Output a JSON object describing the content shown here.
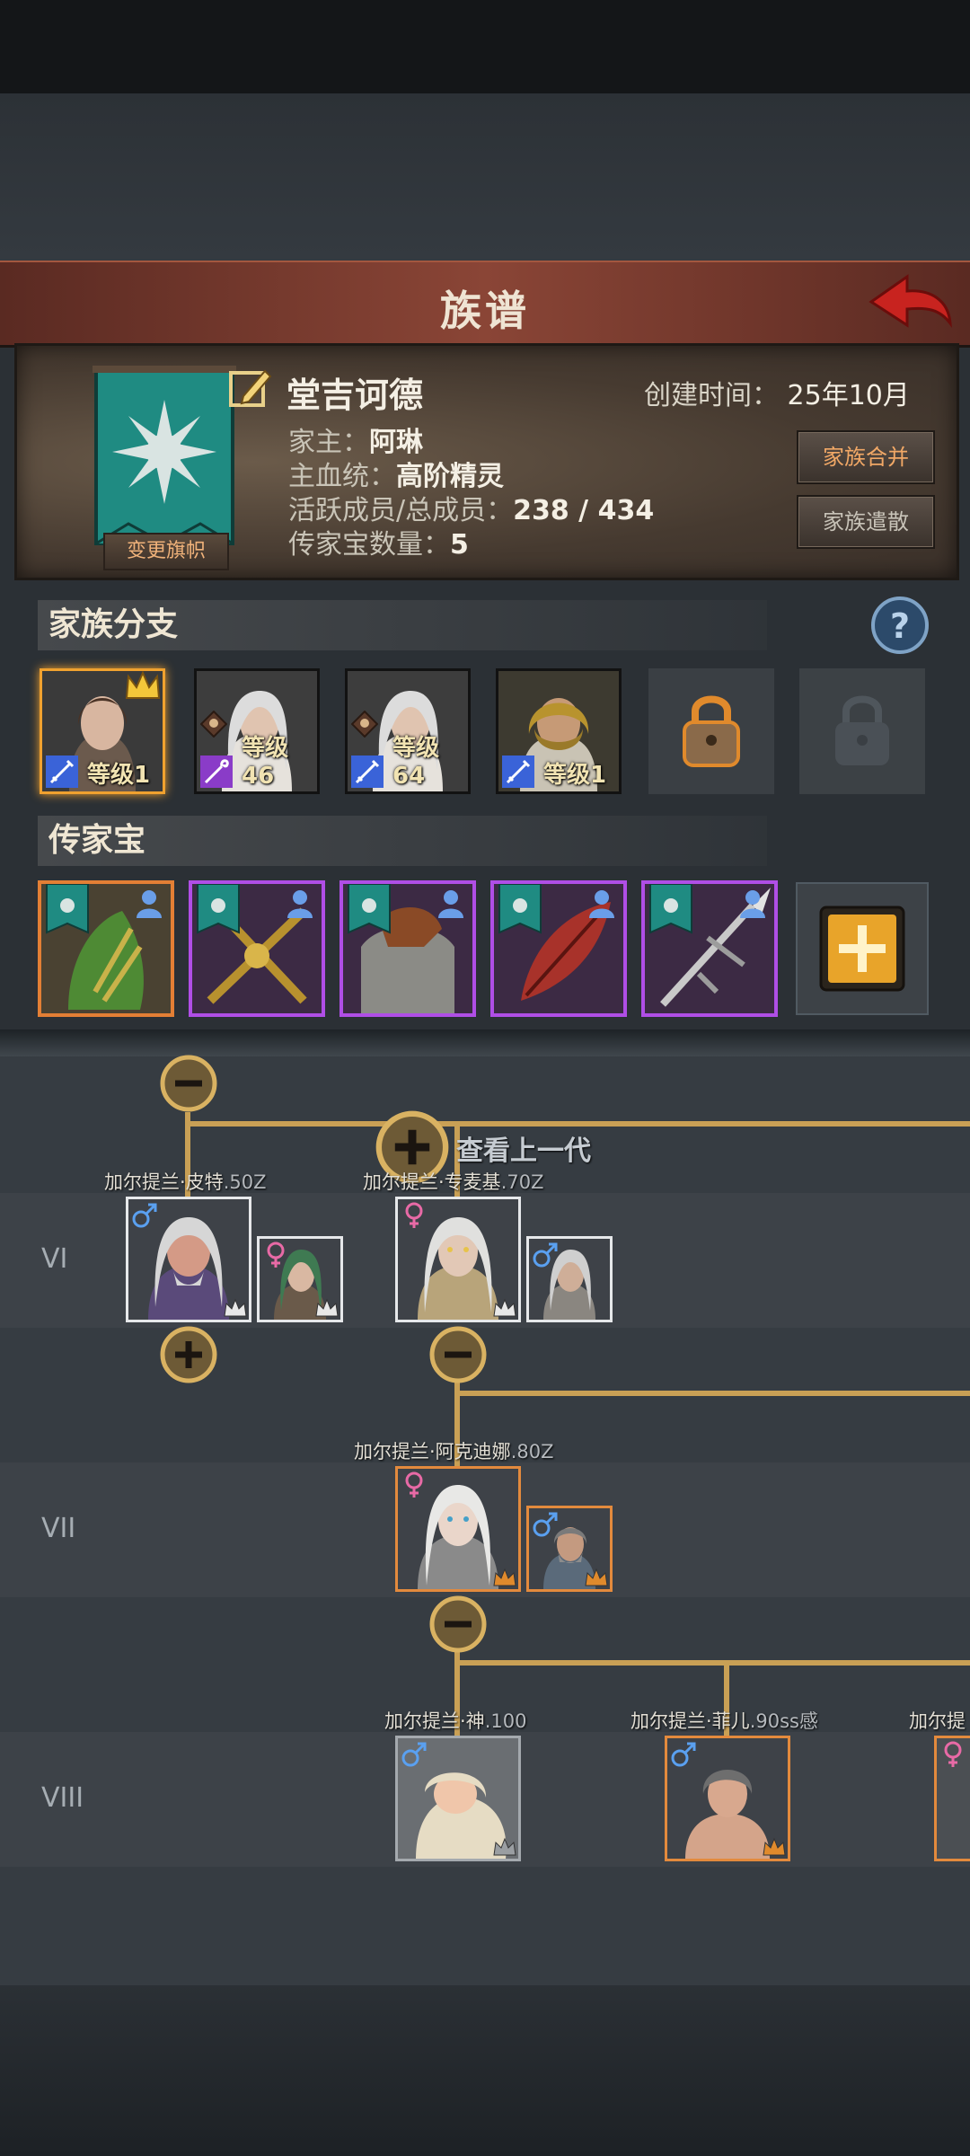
{
  "header": {
    "title": "族谱"
  },
  "family": {
    "name": "堂吉诃德",
    "created_label": "创建时间：",
    "created_value": "25年10月",
    "head_label": "家主：",
    "head_value": "阿琳",
    "bloodline_label": "主血统：",
    "bloodline_value": "高阶精灵",
    "members_label": "活跃成员/总成员：",
    "members_value": "238 / 434",
    "heirloom_count_label": "传家宝数量：",
    "heirloom_count_value": "5",
    "change_banner_label": "变更旗帜",
    "merge_label": "家族合并",
    "disband_label": "家族遣散"
  },
  "branches": {
    "title": "家族分支",
    "items": [
      {
        "level": "等级1",
        "weapon": "sword-icon",
        "crown": true
      },
      {
        "level": "等级46",
        "weapon": "staff-icon"
      },
      {
        "level": "等级64",
        "weapon": "sword-icon"
      },
      {
        "level": "等级1",
        "weapon": "sword-icon"
      }
    ]
  },
  "heirlooms": {
    "title": "传家宝",
    "items": [
      {
        "rarity": "orange",
        "name": "leaf-armor"
      },
      {
        "rarity": "purple",
        "name": "crossed-staves"
      },
      {
        "rarity": "purple",
        "name": "chain-armor"
      },
      {
        "rarity": "purple",
        "name": "red-feather"
      },
      {
        "rarity": "purple",
        "name": "spear"
      }
    ]
  },
  "tree": {
    "view_previous_label": "查看上一代",
    "generations": [
      {
        "label": "VI",
        "members": [
          {
            "name": "加尔提兰·皮特",
            "score": ".50Z",
            "gender": "male",
            "spouse_gender": "female"
          },
          {
            "name": "加尔提兰·专麦基",
            "score": ".70Z",
            "gender": "female",
            "spouse_gender": "male"
          }
        ]
      },
      {
        "label": "VII",
        "members": [
          {
            "name": "加尔提兰·阿克迪娜",
            "score": ".80Z",
            "gender": "female",
            "spouse_gender": "male"
          }
        ]
      },
      {
        "label": "VIII",
        "members": [
          {
            "name": "加尔提兰·神",
            "score": ".100",
            "gender": "male"
          },
          {
            "name": "加尔提兰·菲儿",
            "score": ".90ss感",
            "gender": "male"
          },
          {
            "name": "加尔提",
            "score": "",
            "gender": "female"
          }
        ]
      }
    ]
  },
  "colors": {
    "accent": "#f0a12f",
    "tree_line": "#c9a055",
    "title_bar": "#8a4536"
  }
}
